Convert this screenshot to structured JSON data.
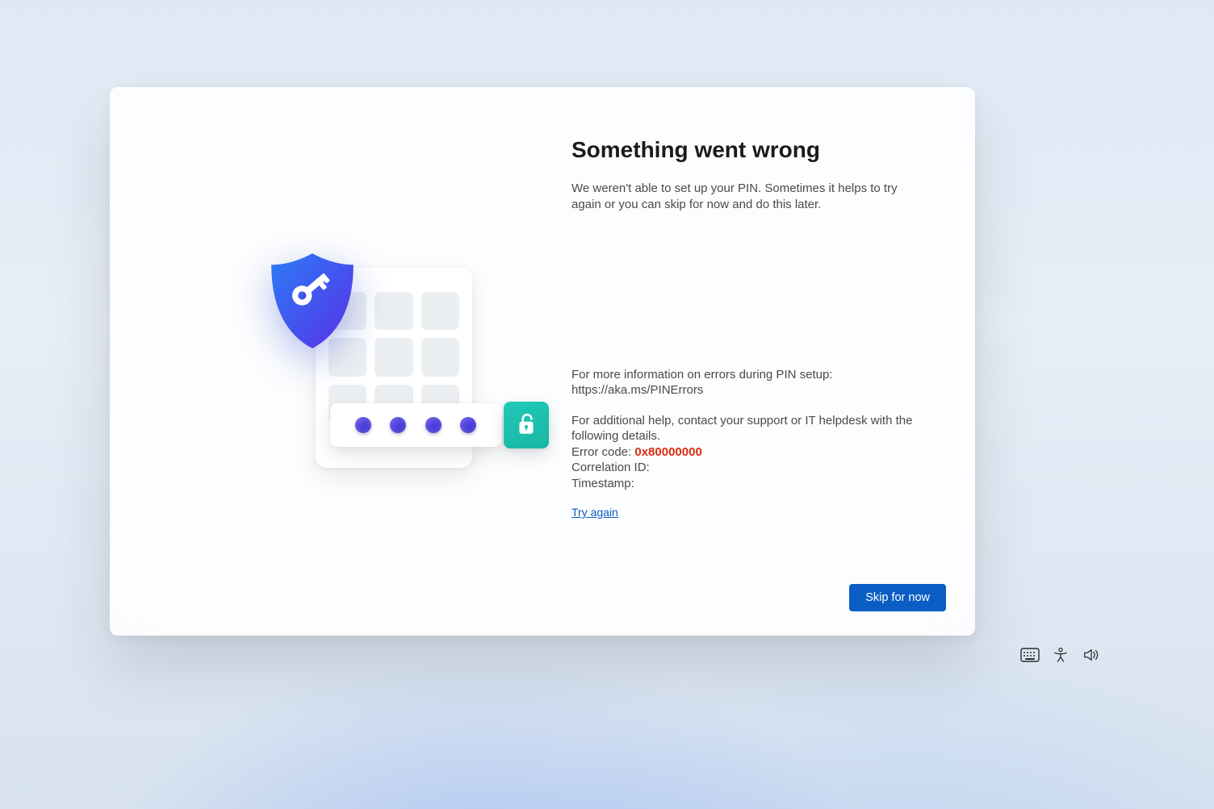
{
  "header": {
    "title": "Something went wrong"
  },
  "description": "We weren't able to set up your PIN. Sometimes it helps to try again or you can skip for now and do this later.",
  "details": {
    "info_line1": "For more information on errors during PIN setup:",
    "info_url": "https://aka.ms/PINErrors",
    "help_line1": "For additional help, contact your support or IT helpdesk with the following details.",
    "error_code_label": "Error code: ",
    "error_code_value": "0x80000000",
    "correlation_label": "Correlation ID:",
    "correlation_value": "",
    "timestamp_label": "Timestamp:",
    "timestamp_value": ""
  },
  "actions": {
    "try_again": "Try again",
    "skip": "Skip for now"
  },
  "icons": {
    "shield": "shield-key-icon",
    "lock": "unlock-icon",
    "keyboard": "keyboard-icon",
    "accessibility": "accessibility-icon",
    "volume": "volume-icon"
  },
  "colors": {
    "accent": "#0a5dc2",
    "error": "#d62e12",
    "shield_start": "#2B7CF6",
    "shield_end": "#5A2FE8",
    "lock_badge": "#1cc2b0"
  }
}
